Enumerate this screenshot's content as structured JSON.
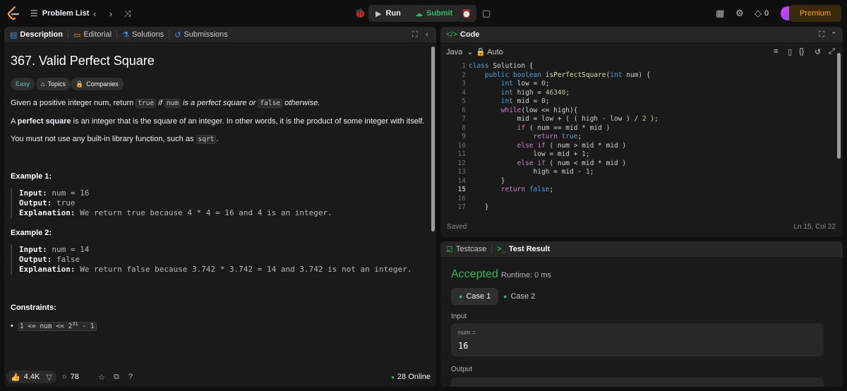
{
  "topbar": {
    "problem_list": "Problem List",
    "run": "Run",
    "submit": "Submit",
    "notifications": "0",
    "premium": "Premium"
  },
  "colors": {
    "accent": "#ffa116",
    "success": "#2cbb5d",
    "bg": "#0f0f0f",
    "panel": "#1a1a1a"
  },
  "desc": {
    "tabs": [
      "Description",
      "Editorial",
      "Solutions",
      "Submissions"
    ],
    "title": "367. Valid Perfect Square",
    "difficulty": "Easy",
    "topics": "Topics",
    "companies": "Companies",
    "para1": [
      "Given a positive integer num, return ",
      "true",
      " if ",
      "num",
      " is a perfect square or ",
      "false",
      " otherwise."
    ],
    "para2": [
      "A ",
      "perfect square",
      " is an integer that is the square of an integer. In other words, it is the product of some integer with itself."
    ],
    "para3": [
      "You must not use any built-in library function, such as ",
      "sqrt",
      "."
    ],
    "ex1_title": "Example 1:",
    "ex1": {
      "input_label": "Input:",
      "input": " num = 16",
      "output_label": "Output:",
      "output": " true",
      "expl_label": "Explanation:",
      "expl": " We return true because 4 * 4 = 16 and 4 is an integer."
    },
    "ex2_title": "Example 2:",
    "ex2": {
      "input_label": "Input:",
      "input": " num = 14",
      "output_label": "Output:",
      "output": " false",
      "expl_label": "Explanation:",
      "expl": " We return false because 3.742 * 3.742 = 14 and 3.742 is not an integer."
    },
    "constraints_title": "Constraints:",
    "constraint": "1 <= num <= 2",
    "constraint_sup": "31",
    "constraint_tail": " - 1",
    "likes": "4.4K",
    "comments": "78",
    "online": "28 Online"
  },
  "code": {
    "title": "Code",
    "language": "Java",
    "mode": "Auto",
    "lines": [
      "1",
      "2",
      "3",
      "4",
      "5",
      "6",
      "7",
      "8",
      "9",
      "10",
      "11",
      "12",
      "13",
      "14",
      "15",
      "16",
      "17"
    ],
    "current_line": "15",
    "saved": "Saved",
    "cursor": "Ln 15, Col 22"
  },
  "result": {
    "tabs": [
      "Testcase",
      "Test Result"
    ],
    "status": "Accepted",
    "runtime": "Runtime: 0 ms",
    "cases": [
      "Case 1",
      "Case 2"
    ],
    "input_label": "Input",
    "param_label": "num =",
    "param_value": "16",
    "output_label": "Output"
  }
}
